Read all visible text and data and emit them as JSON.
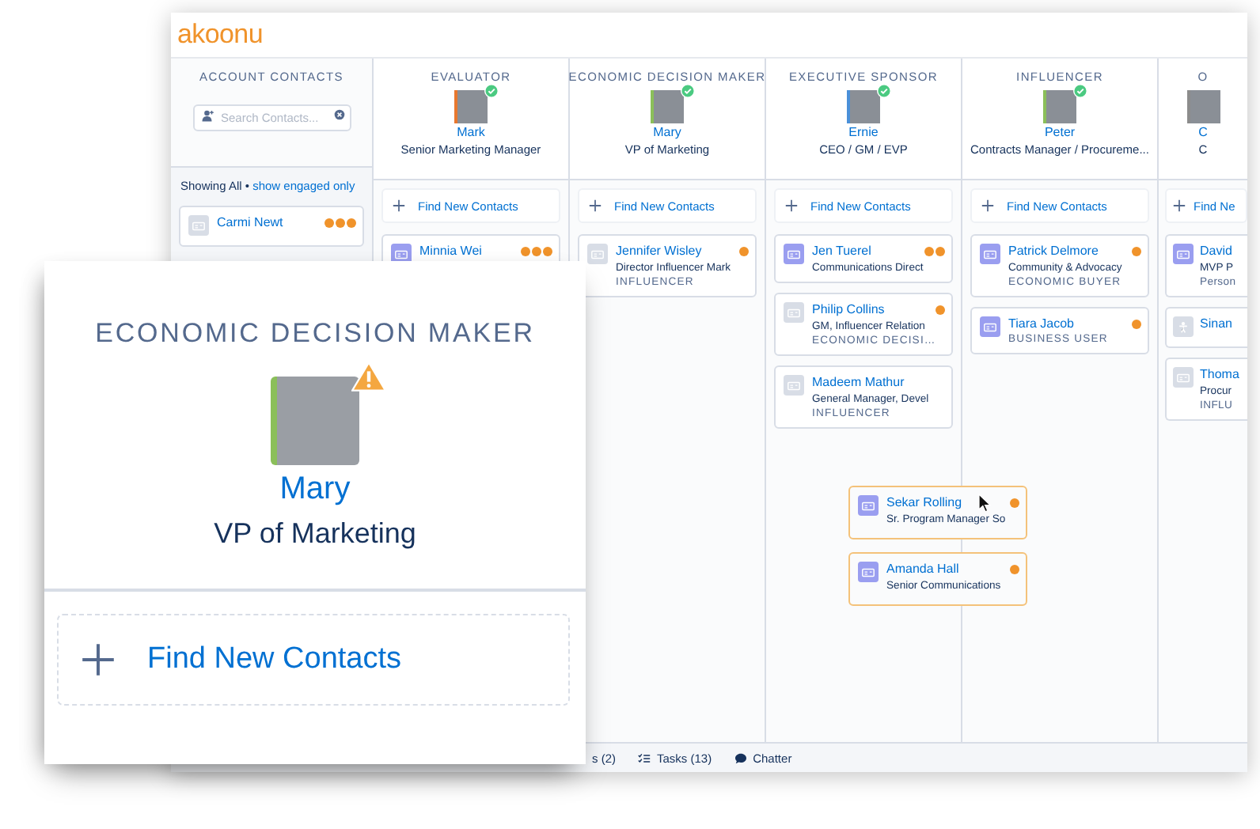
{
  "app": {
    "logo": "akoonu"
  },
  "account_contacts": {
    "title": "ACCOUNT CONTACTS",
    "search": {
      "placeholder": "Search Contacts..."
    },
    "filter": {
      "text": "Showing  All • ",
      "link": "show engaged only"
    },
    "contacts": [
      {
        "name": "Carmi Newt",
        "kind": "contact",
        "engaged": false,
        "dots": [
          {
            "color": "#f0932b"
          },
          {
            "color": "#f0932b"
          },
          {
            "color": "#f0932b"
          }
        ]
      }
    ]
  },
  "roles": [
    {
      "title": "EVALUATOR",
      "person": {
        "name": "Mark",
        "job": "Senior Marketing Manager",
        "color": "#e8772e",
        "verified": true
      },
      "action": "Find New Contacts",
      "cards": [
        {
          "name": "Minnia Wei",
          "kind": "contact",
          "engaged": true,
          "dots": [
            {
              "color": "#f0932b"
            },
            {
              "color": "#f0932b"
            },
            {
              "color": "#f0932b"
            }
          ]
        }
      ]
    },
    {
      "title": "ECONOMIC DECISION MAKER",
      "person": {
        "name": "Mary",
        "job": "VP of Marketing",
        "color": "#8bbf5a",
        "verified": true
      },
      "action": "Find New Contacts",
      "cards": [
        {
          "name": "Jennifer Wisley",
          "job": "Director Influencer Mark",
          "role": "INFLUENCER",
          "kind": "contact",
          "engaged": false,
          "dots": [
            {
              "color": "#f0932b"
            }
          ]
        }
      ]
    },
    {
      "title": "EXECUTIVE SPONSOR",
      "person": {
        "name": "Ernie",
        "job": "CEO / GM / EVP",
        "color": "#4a90d9",
        "verified": true
      },
      "action": "Find New Contacts",
      "cards": [
        {
          "name": "Jen Tuerel",
          "job": "Communications Direct",
          "kind": "contact",
          "engaged": true,
          "dots": [
            {
              "color": "#f0932b"
            },
            {
              "color": "#f0932b"
            }
          ]
        },
        {
          "name": "Philip Collins",
          "job": "GM, Influencer Relation",
          "role": "ECONOMIC DECISI…",
          "kind": "contact",
          "engaged": false,
          "dots": [
            {
              "color": "#f0932b"
            }
          ]
        },
        {
          "name": "Madeem Mathur",
          "job": "General Manager, Devel",
          "role": "INFLUENCER",
          "kind": "contact",
          "engaged": false
        }
      ]
    },
    {
      "title": "INFLUENCER",
      "person": {
        "name": "Peter",
        "job": "Contracts Manager / Procureme...",
        "color": "#8bbf5a",
        "verified": true
      },
      "action": "Find New Contacts",
      "cards": [
        {
          "name": "Patrick Delmore",
          "job": "Community & Advocacy",
          "role": "ECONOMIC BUYER",
          "kind": "contact",
          "engaged": true,
          "dots": [
            {
              "color": "#f0932b"
            }
          ]
        },
        {
          "name": "Tiara Jacob",
          "role": "BUSINESS USER",
          "kind": "contact",
          "engaged": true,
          "dots": [
            {
              "color": "#f0932b"
            }
          ]
        }
      ]
    },
    {
      "title": "O",
      "person": {
        "name": "C",
        "job": "C",
        "color": "#8c8c8c"
      },
      "action": "Find Ne",
      "cards": [
        {
          "name": "David",
          "job": "MVP P",
          "role": "Person",
          "kind": "contact",
          "engaged": true
        },
        {
          "name": "Sinan",
          "kind": "person",
          "engaged": false
        },
        {
          "name": "Thoma",
          "job": "Procur",
          "role": "INFLU",
          "kind": "contact",
          "engaged": false
        }
      ]
    }
  ],
  "dragged_cards": [
    {
      "name": "Sekar Rolling",
      "job": "Sr. Program Manager So",
      "kind": "contact",
      "engaged": true,
      "dots": [
        {
          "color": "#f0932b"
        }
      ]
    },
    {
      "name": "Amanda Hall",
      "job": "Senior Communications",
      "kind": "contact",
      "engaged": true,
      "dots": [
        {
          "color": "#f0932b"
        }
      ]
    }
  ],
  "status_bar": [
    {
      "label": "s (2)",
      "kind": "plain"
    },
    {
      "label": "Tasks (13)",
      "kind": "tasks"
    },
    {
      "label": "Chatter",
      "kind": "chat"
    }
  ],
  "zoom_panel": {
    "title": "ECONOMIC DECISION MAKER",
    "person": {
      "name": "Mary",
      "job": "VP of Marketing",
      "color": "#8bbf5a",
      "warning": true
    },
    "action": "Find New Contacts"
  }
}
